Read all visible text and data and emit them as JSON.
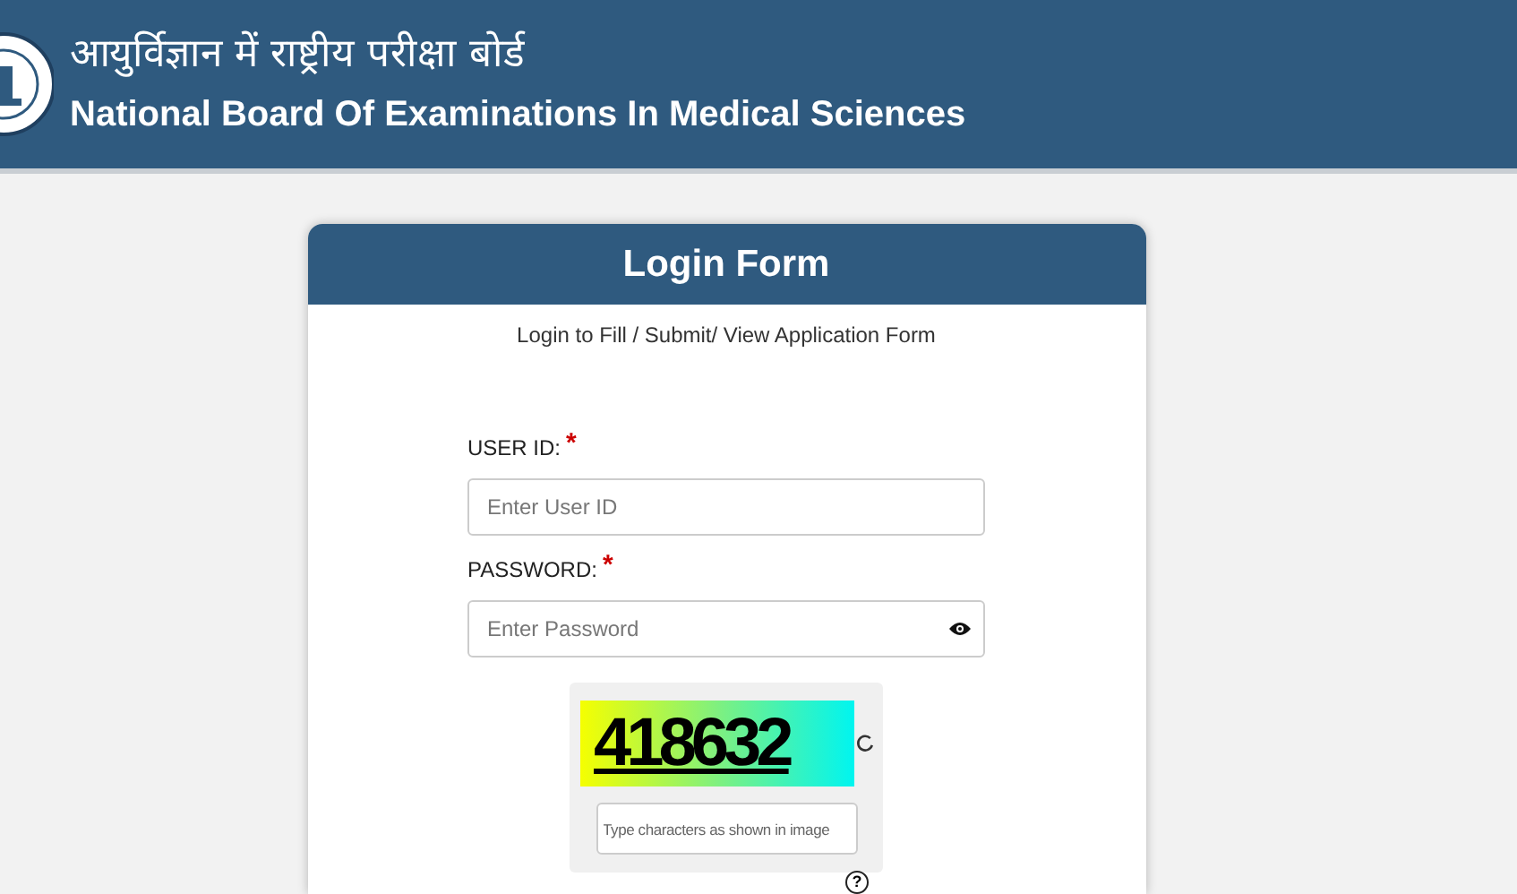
{
  "header": {
    "title_hindi": "आयुर्विज्ञान में राष्ट्रीय परीक्षा बोर्ड",
    "title_english": "National Board Of Examinations In Medical Sciences"
  },
  "login_form": {
    "title": "Login Form",
    "subtitle": "Login to Fill / Submit/ View Application Form",
    "fields": [
      {
        "label": "USER ID:",
        "required": true,
        "placeholder": "Enter User ID",
        "kind": "text"
      },
      {
        "label": "PASSWORD:",
        "required": true,
        "placeholder": "Enter Password",
        "kind": "password"
      }
    ],
    "captcha": {
      "text": "418632",
      "placeholder": "Type characters as shown in image"
    },
    "required_mark": "*",
    "help": "?"
  }
}
